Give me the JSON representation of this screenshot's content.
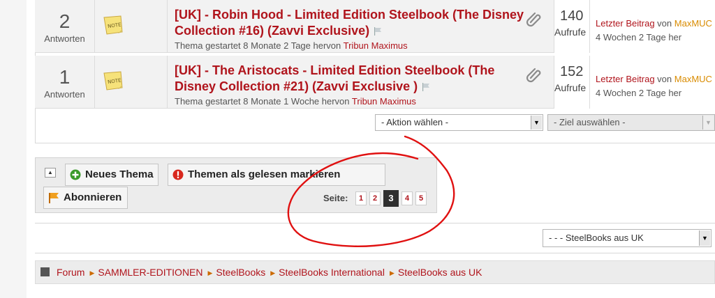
{
  "threads": [
    {
      "replies": "2",
      "replies_label": "Antworten",
      "title": "[UK] - Robin Hood - Limited Edition Steelbook (The Disney Collection #16) (Zavvi Exclusive)",
      "meta_prefix": "Thema gestartet 8 Monate 2 Tage hervon",
      "author": "Tribun Maximus",
      "views": "140",
      "views_label": "Aufrufe",
      "last_post_link": "Letzter Beitrag",
      "last_post_by": "von",
      "last_post_user": "MaxMUC",
      "last_post_time": "4 Wochen 2 Tage her"
    },
    {
      "replies": "1",
      "replies_label": "Antworten",
      "title": "[UK] - The Aristocats - Limited Edition Steelbook (The Disney Collection #21) (Zavvi Exclusive )",
      "meta_prefix": "Thema gestartet 8 Monate 1 Woche hervon",
      "author": "Tribun Maximus",
      "views": "152",
      "views_label": "Aufrufe",
      "last_post_link": "Letzter Beitrag",
      "last_post_by": "von",
      "last_post_user": "MaxMUC",
      "last_post_time": "4 Wochen 2 Tage her"
    }
  ],
  "actions": {
    "action_select": "- Aktion wählen -",
    "target_select": "- Ziel auswählen -"
  },
  "controls": {
    "new_thread": "Neues Thema",
    "mark_read": "Themen als gelesen markieren",
    "subscribe": "Abonnieren"
  },
  "pager": {
    "label": "Seite:",
    "pages": [
      "1",
      "2",
      "3",
      "4",
      "5"
    ],
    "current": "3"
  },
  "forum_jump": {
    "selected": "- - - SteelBooks aus UK"
  },
  "breadcrumb": [
    "Forum",
    "SAMMLER-EDITIONEN",
    "SteelBooks",
    "SteelBooks International",
    "SteelBooks aus UK"
  ],
  "colors": {
    "link_red": "#b0141c",
    "username_orange": "#d98b00",
    "annotation_red": "#e01010"
  },
  "icons": {
    "thread": "sticky-note-icon",
    "attachment": "paperclip-icon",
    "flag": "flag-icon",
    "new_thread": "plus-circle-icon",
    "mark_read": "exclamation-circle-icon",
    "subscribe": "orange-flag-icon",
    "breadcrumb_home": "square-home-icon"
  }
}
